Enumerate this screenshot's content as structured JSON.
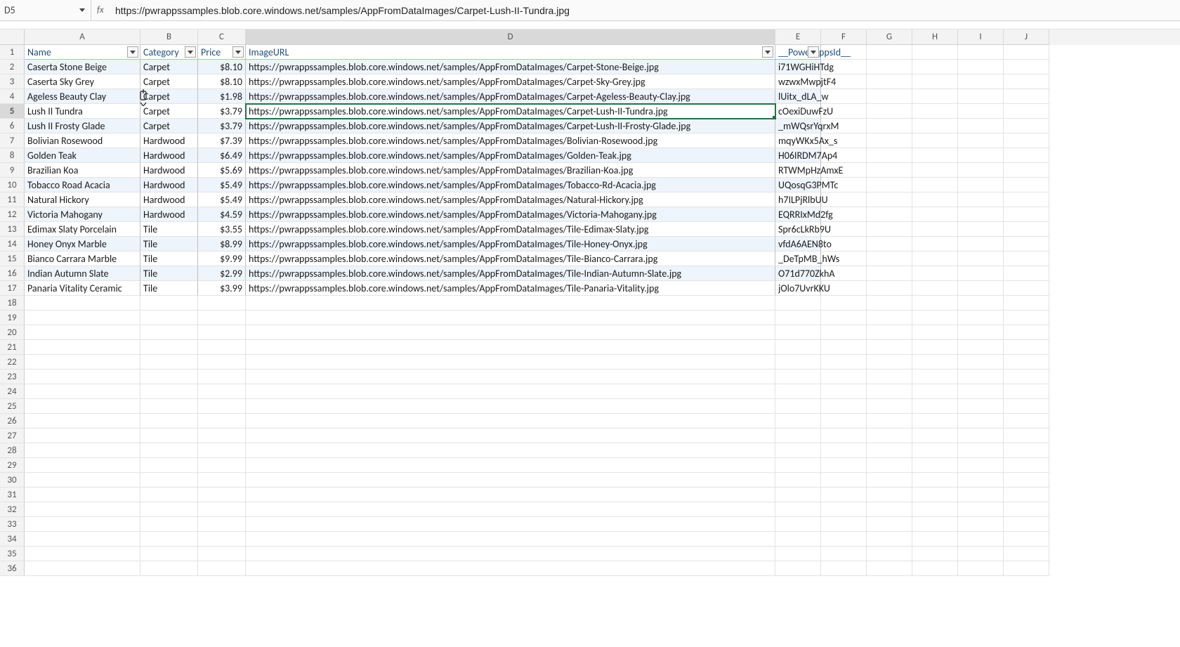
{
  "nameBox": "D5",
  "fxLabel": "fx",
  "formulaValue": "https://pwrappssamples.blob.core.windows.net/samples/AppFromDataImages/Carpet-Lush-II-Tundra.jpg",
  "columns": [
    "A",
    "B",
    "C",
    "D",
    "E",
    "F",
    "G",
    "H",
    "I",
    "J"
  ],
  "colWidths": [
    "wA",
    "wB",
    "wC",
    "wD",
    "wE",
    "wF",
    "wG",
    "wH",
    "wI",
    "wJ"
  ],
  "activeCol": "D",
  "activeRow": 5,
  "headers": {
    "A": "Name",
    "B": "Category",
    "C": "Price",
    "D": "ImageURL",
    "E": "__PowerAppsId__"
  },
  "rows": [
    {
      "r": 2,
      "A": "Caserta Stone Beige",
      "B": "Carpet",
      "C": "$8.10",
      "D": "https://pwrappssamples.blob.core.windows.net/samples/AppFromDataImages/Carpet-Stone-Beige.jpg",
      "E": "i71WGHiHTdg",
      "band": true
    },
    {
      "r": 3,
      "A": "Caserta Sky Grey",
      "B": "Carpet",
      "C": "$8.10",
      "D": "https://pwrappssamples.blob.core.windows.net/samples/AppFromDataImages/Carpet-Sky-Grey.jpg",
      "E": "wzwxMwpjtF4",
      "band": false
    },
    {
      "r": 4,
      "A": "Ageless Beauty Clay",
      "B": "Carpet",
      "C": "$1.98",
      "D": "https://pwrappssamples.blob.core.windows.net/samples/AppFromDataImages/Carpet-Ageless-Beauty-Clay.jpg",
      "E": "lUitx_dLA_w",
      "band": true
    },
    {
      "r": 5,
      "A": "Lush II Tundra",
      "B": "Carpet",
      "C": "$3.79",
      "D": "https://pwrappssamples.blob.core.windows.net/samples/AppFromDataImages/Carpet-Lush-II-Tundra.jpg",
      "E": "cOexiDuwFzU",
      "band": false
    },
    {
      "r": 6,
      "A": "Lush II Frosty Glade",
      "B": "Carpet",
      "C": "$3.79",
      "D": "https://pwrappssamples.blob.core.windows.net/samples/AppFromDataImages/Carpet-Lush-II-Frosty-Glade.jpg",
      "E": "_mWQsrYqrxM",
      "band": true
    },
    {
      "r": 7,
      "A": "Bolivian Rosewood",
      "B": "Hardwood",
      "C": "$7.39",
      "D": "https://pwrappssamples.blob.core.windows.net/samples/AppFromDataImages/Bolivian-Rosewood.jpg",
      "E": "mqyWKx5Ax_s",
      "band": false
    },
    {
      "r": 8,
      "A": "Golden Teak",
      "B": "Hardwood",
      "C": "$6.49",
      "D": "https://pwrappssamples.blob.core.windows.net/samples/AppFromDataImages/Golden-Teak.jpg",
      "E": "H06IRDM7Ap4",
      "band": true
    },
    {
      "r": 9,
      "A": "Brazilian Koa",
      "B": "Hardwood",
      "C": "$5.69",
      "D": "https://pwrappssamples.blob.core.windows.net/samples/AppFromDataImages/Brazilian-Koa.jpg",
      "E": "RTWMpHzAmxE",
      "band": false
    },
    {
      "r": 10,
      "A": "Tobacco Road Acacia",
      "B": "Hardwood",
      "C": "$5.49",
      "D": "https://pwrappssamples.blob.core.windows.net/samples/AppFromDataImages/Tobacco-Rd-Acacia.jpg",
      "E": "UQosqG3PMTc",
      "band": true
    },
    {
      "r": 11,
      "A": "Natural Hickory",
      "B": "Hardwood",
      "C": "$5.49",
      "D": "https://pwrappssamples.blob.core.windows.net/samples/AppFromDataImages/Natural-Hickory.jpg",
      "E": "h7ILPjRlbUU",
      "band": false
    },
    {
      "r": 12,
      "A": "Victoria Mahogany",
      "B": "Hardwood",
      "C": "$4.59",
      "D": "https://pwrappssamples.blob.core.windows.net/samples/AppFromDataImages/Victoria-Mahogany.jpg",
      "E": "EQRRIxMd2fg",
      "band": true
    },
    {
      "r": 13,
      "A": "Edimax Slaty Porcelain",
      "B": "Tile",
      "C": "$3.55",
      "D": "https://pwrappssamples.blob.core.windows.net/samples/AppFromDataImages/Tile-Edimax-Slaty.jpg",
      "E": "Spr6cLkRb9U",
      "band": false
    },
    {
      "r": 14,
      "A": "Honey Onyx Marble",
      "B": "Tile",
      "C": "$8.99",
      "D": "https://pwrappssamples.blob.core.windows.net/samples/AppFromDataImages/Tile-Honey-Onyx.jpg",
      "E": "vfdA6AEN8to",
      "band": true
    },
    {
      "r": 15,
      "A": "Bianco Carrara Marble",
      "B": "Tile",
      "C": "$9.99",
      "D": "https://pwrappssamples.blob.core.windows.net/samples/AppFromDataImages/Tile-Bianco-Carrara.jpg",
      "E": "_DeTpMB_hWs",
      "band": false
    },
    {
      "r": 16,
      "A": "Indian Autumn Slate",
      "B": "Tile",
      "C": "$2.99",
      "D": "https://pwrappssamples.blob.core.windows.net/samples/AppFromDataImages/Tile-Indian-Autumn-Slate.jpg",
      "E": "O71d770ZkhA",
      "band": true
    },
    {
      "r": 17,
      "A": "Panaria Vitality Ceramic",
      "B": "Tile",
      "C": "$3.99",
      "D": "https://pwrappssamples.blob.core.windows.net/samples/AppFromDataImages/Tile-Panaria-Vitality.jpg",
      "E": "jOlo7UvrKKU",
      "band": false
    }
  ],
  "emptyRowsStart": 18,
  "emptyRowsEnd": 36
}
